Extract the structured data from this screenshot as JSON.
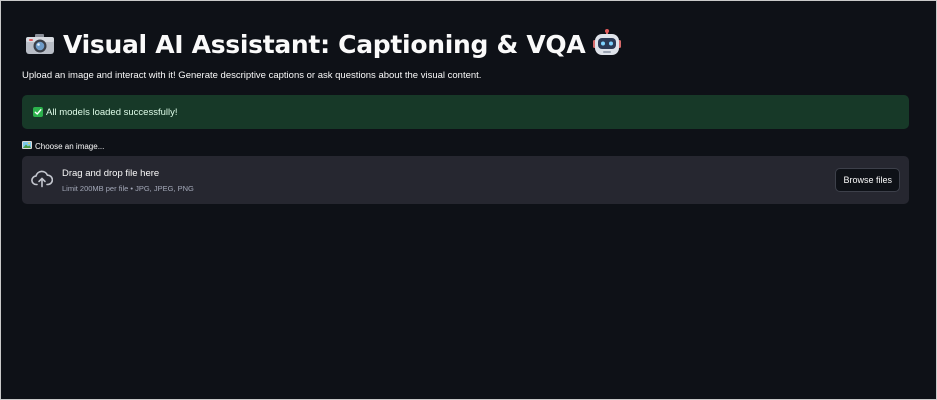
{
  "header": {
    "title": "Visual AI Assistant: Captioning & VQA",
    "leading_icon": "camera-icon",
    "trailing_icon": "robot-icon"
  },
  "subtitle": "Upload an image and interact with it! Generate descriptive captions or ask questions about the visual content.",
  "status": {
    "icon": "check-icon",
    "message": "All models loaded successfully!",
    "color": "#173928"
  },
  "uploader": {
    "icon": "picture-icon",
    "label": "Choose an image...",
    "drop_text": "Drag and drop file here",
    "limit_text": "Limit 200MB per file • JPG, JPEG, PNG",
    "browse_label": "Browse files"
  },
  "theme": {
    "background": "#0e1117",
    "surface": "#262730",
    "text": "#fafafa",
    "muted_text": "#a3a8b8",
    "success": "#2bb24c"
  }
}
